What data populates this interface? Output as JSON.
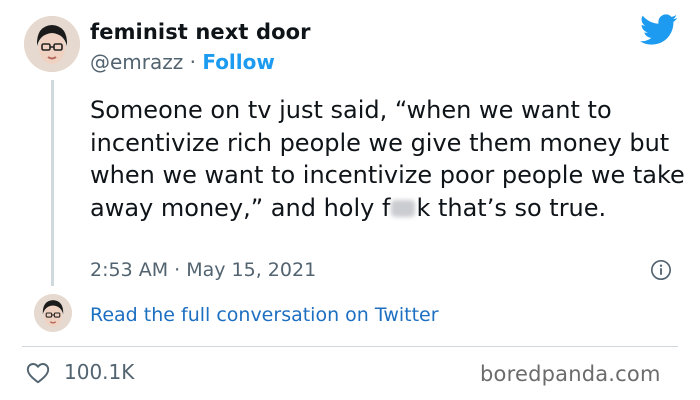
{
  "author": {
    "display_name": "feminist next door",
    "handle": "@emrazz",
    "separator": " · ",
    "follow_label": "Follow"
  },
  "tweet": {
    "text_before": "Someone on tv just said, “when we want to incentivize rich people we give them money but when we want to incentivize poor people we take away money,” and holy f",
    "text_after": "k that’s so true.",
    "time": "2:53 AM",
    "separator": " · ",
    "date": "May 15, 2021"
  },
  "thread": {
    "read_link": "Read the full conversation on Twitter"
  },
  "engagement": {
    "likes": "100.1K"
  },
  "watermark": "boredpanda.com",
  "icons": {
    "brand": "twitter-bird-icon",
    "info": "info-icon",
    "like": "heart-icon"
  },
  "colors": {
    "accent": "#1d9bf0",
    "link": "#1d6fc2",
    "secondary_text": "#536471",
    "divider": "#cfd9de"
  }
}
